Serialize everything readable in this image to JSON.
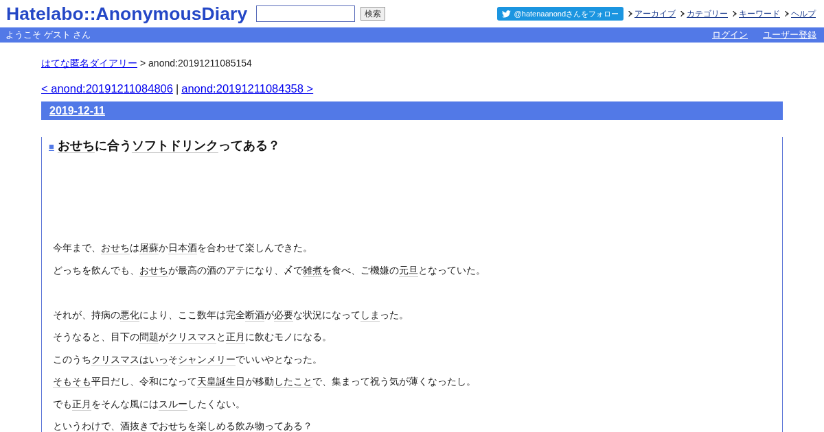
{
  "header": {
    "logo": "Hatelabo::AnonymousDiary",
    "search": {
      "button": "検索"
    },
    "follow_button": "@hatenaanondさんをフォロー",
    "nav_links": [
      "アーカイブ",
      "カテゴリー",
      "キーワード",
      "ヘルプ"
    ]
  },
  "user_bar": {
    "greeting": "ようこそ ゲスト さん",
    "links": [
      "ログイン",
      "ユーザー登録"
    ]
  },
  "breadcrumb": {
    "link": "はてな匿名ダイアリー",
    "current": "> anond:20191211085154"
  },
  "pager": {
    "prev": "< anond:20191211084806",
    "separator": "|",
    "next": "anond:20191211084358 >"
  },
  "section": {
    "date": "2019-12-11",
    "anchor": "■",
    "title": [
      {
        "kind": "keyword",
        "text": "おせち"
      },
      {
        "kind": "text",
        "text": "に合う"
      },
      {
        "kind": "keyword",
        "text": "ソフトドリンク"
      },
      {
        "kind": "text",
        "text": "ってある？"
      }
    ],
    "paragraphs": [
      [
        [
          {
            "kind": "text",
            "text": "今年まで、"
          },
          {
            "kind": "keyword",
            "text": "おせち"
          },
          {
            "kind": "text",
            "text": "は"
          },
          {
            "kind": "keyword",
            "text": "屠蘇"
          },
          {
            "kind": "text",
            "text": "か"
          },
          {
            "kind": "keyword",
            "text": "日本酒"
          },
          {
            "kind": "text",
            "text": "を合わせて楽しんできた。"
          }
        ],
        [
          {
            "kind": "text",
            "text": "どっちを飲んでも、"
          },
          {
            "kind": "keyword",
            "text": "おせち"
          },
          {
            "kind": "text",
            "text": "が最高の酒のアテになり、〆で"
          },
          {
            "kind": "keyword",
            "text": "雑煮"
          },
          {
            "kind": "text",
            "text": "を食べ、ご機嫌の"
          },
          {
            "kind": "keyword",
            "text": "元旦"
          },
          {
            "kind": "text",
            "text": "となっていた。"
          }
        ]
      ],
      [
        [
          {
            "kind": "text",
            "text": "それが、持病の"
          },
          {
            "kind": "keyword",
            "text": "悪化"
          },
          {
            "kind": "text",
            "text": "により、ここ数年は完全"
          },
          {
            "kind": "keyword",
            "text": "断酒"
          },
          {
            "kind": "text",
            "text": "が"
          },
          {
            "kind": "keyword",
            "text": "必要"
          },
          {
            "kind": "text",
            "text": "な状況になって"
          },
          {
            "kind": "keyword",
            "text": "しま"
          },
          {
            "kind": "text",
            "text": "った。"
          }
        ],
        [
          {
            "kind": "text",
            "text": "そうなると、目下の"
          },
          {
            "kind": "keyword",
            "text": "問題"
          },
          {
            "kind": "text",
            "text": "が"
          },
          {
            "kind": "keyword",
            "text": "クリスマス"
          },
          {
            "kind": "text",
            "text": "と"
          },
          {
            "kind": "keyword",
            "text": "正月"
          },
          {
            "kind": "text",
            "text": "に飲むモノになる。"
          }
        ],
        [
          {
            "kind": "text",
            "text": "このうち"
          },
          {
            "kind": "keyword",
            "text": "クリスマス"
          },
          {
            "kind": "keyword",
            "text": "はいっ"
          },
          {
            "kind": "text",
            "text": "そ"
          },
          {
            "kind": "keyword",
            "text": "シャンメリー"
          },
          {
            "kind": "text",
            "text": "でいいやとなった。"
          }
        ],
        [
          {
            "kind": "keyword",
            "text": "そもそも"
          },
          {
            "kind": "text",
            "text": "平日だし、令和になって"
          },
          {
            "kind": "keyword",
            "text": "天皇誕生日"
          },
          {
            "kind": "text",
            "text": "が移動"
          },
          {
            "kind": "keyword",
            "text": "したこと"
          },
          {
            "kind": "text",
            "text": "で、集まって祝う気が薄くなったし。"
          }
        ],
        [
          {
            "kind": "text",
            "text": "でも"
          },
          {
            "kind": "keyword",
            "text": "正月"
          },
          {
            "kind": "text",
            "text": "をそんな風には"
          },
          {
            "kind": "keyword",
            "text": "スルー"
          },
          {
            "kind": "text",
            "text": "したくない。"
          }
        ],
        [
          {
            "kind": "text",
            "text": "というわけで、酒抜きで"
          },
          {
            "kind": "keyword",
            "text": "おせち"
          },
          {
            "kind": "text",
            "text": "を楽しめる"
          },
          {
            "kind": "keyword",
            "text": "飲み物"
          },
          {
            "kind": "text",
            "text": "ってある？"
          }
        ]
      ]
    ]
  }
}
